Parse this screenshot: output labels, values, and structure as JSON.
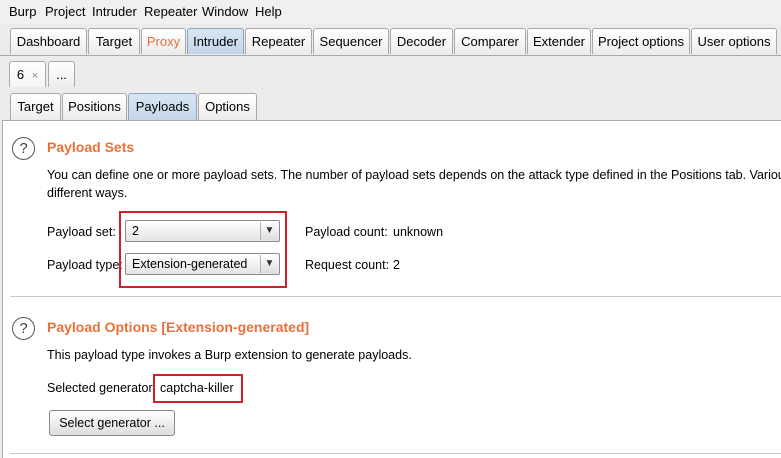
{
  "menu": [
    "Burp",
    "Project",
    "Intruder",
    "Repeater",
    "Window",
    "Help"
  ],
  "main_tabs": [
    "Dashboard",
    "Target",
    "Proxy",
    "Intruder",
    "Repeater",
    "Sequencer",
    "Decoder",
    "Comparer",
    "Extender",
    "Project options",
    "User options"
  ],
  "attack_tabs": {
    "current": "6",
    "close": "×",
    "more": "..."
  },
  "sub_tabs": [
    "Target",
    "Positions",
    "Payloads",
    "Options"
  ],
  "payload_sets": {
    "title": "Payload Sets",
    "description": "You can define one or more payload sets. The number of payload sets depends on the attack type defined in the Positions tab. Various",
    "description2": "different ways.",
    "set_label": "Payload set:",
    "set_value": "2",
    "type_label": "Payload type:",
    "type_value": "Extension-generated",
    "count_label": "Payload count:",
    "count_value": "unknown",
    "request_label": "Request count:",
    "request_value": "2"
  },
  "payload_options": {
    "title": "Payload Options [Extension-generated]",
    "description": "This payload type invokes a Burp extension to generate payloads.",
    "generator_label": "Selected generator:",
    "generator_value": "captcha-killer",
    "select_button": "Select generator ..."
  },
  "icons": {
    "help": "?",
    "dropdown": "▼"
  },
  "colors": {
    "accent": "#e8703a",
    "highlight": "#d0202a",
    "active_tab": "#c3d6e9"
  }
}
